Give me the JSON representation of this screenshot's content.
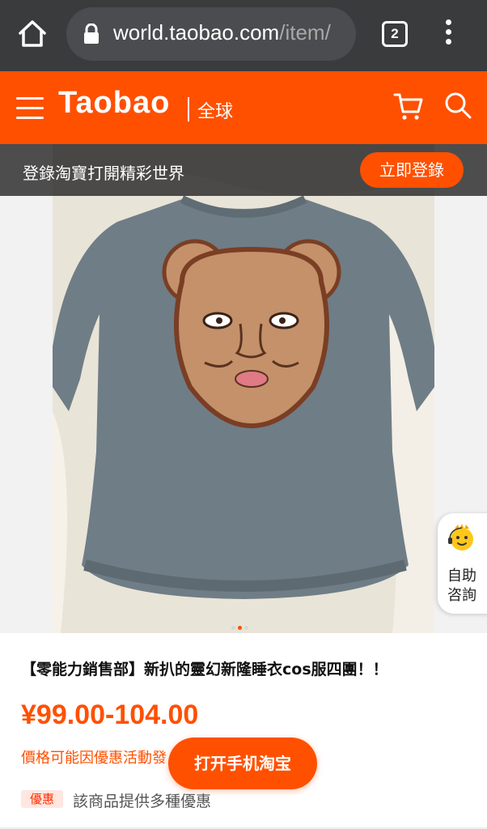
{
  "browser": {
    "url_host": "world.taobao.com",
    "url_path": "/item/",
    "tab_count": "2"
  },
  "header": {
    "brand": "Taobao",
    "brand_sub": "全球"
  },
  "login_bar": {
    "text": "登錄淘寶打開精彩世界",
    "button": "立即登錄"
  },
  "support": {
    "label": "自助咨詢"
  },
  "product": {
    "title": "【零能力銷售部】新扒的靈幻新隆睡衣cos服四團！！",
    "price": "¥99.00-104.00",
    "price_note": "價格可能因優惠活動發",
    "open_app_button": "打开手机淘宝",
    "promo_badge": "優惠",
    "promo_text": "該商品提供多種優惠"
  },
  "colors": {
    "accent": "#ff5000",
    "browser_bar": "#3a3b3d",
    "sweater": "#6f7d86",
    "bear_face": "#c4916a"
  },
  "icons": [
    "home-icon",
    "lock-icon",
    "tab-switcher-icon",
    "overflow-menu-icon",
    "hamburger-icon",
    "cart-icon",
    "search-icon",
    "support-mascot-icon"
  ]
}
